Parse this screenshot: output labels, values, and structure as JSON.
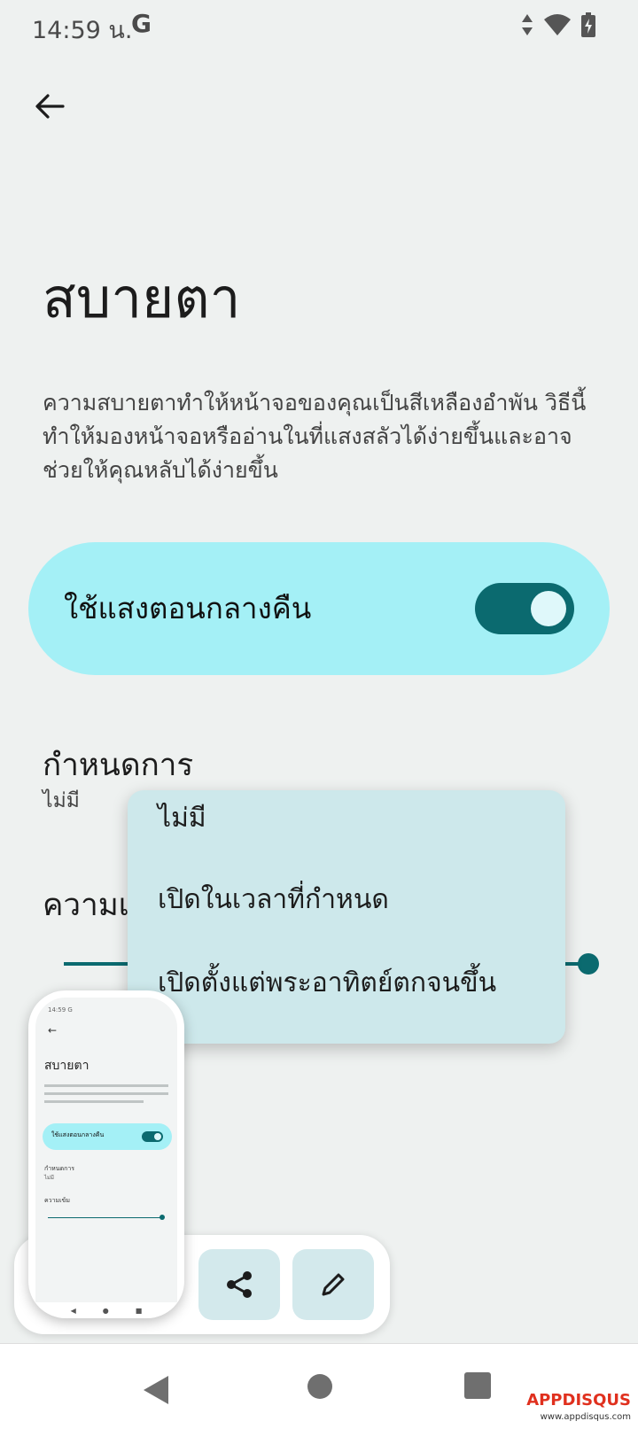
{
  "status_bar": {
    "time": "14:59 น.",
    "carrier_icon": "G"
  },
  "header": {
    "title": "สบายตา"
  },
  "description": "ความสบายตาทำให้หน้าจอของคุณเป็นสีเหลืองอำพัน วิธีนี้ทำให้มองหน้าจอหรืออ่านในที่แสงสลัวได้ง่ายขึ้นและอาจช่วยให้คุณหลับได้ง่ายขึ้น",
  "night_light": {
    "label": "ใช้แสงตอนกลางคืน",
    "enabled": true
  },
  "schedule": {
    "title": "กำหนดการ",
    "value": "ไม่มี"
  },
  "intensity": {
    "title": "ความเข้ม",
    "visible_title": "ความเ",
    "level": 1.0
  },
  "dropdown": {
    "options": [
      "ไม่มี",
      "เปิดในเวลาที่กำหนด",
      "เปิดตั้งแต่พระอาทิตย์ตกจนขึ้น"
    ]
  },
  "screenshot_preview": {
    "time": "14:59 G",
    "title": "สบายตา",
    "toggle_label": "ใช้แสงตอนกลางคืน",
    "schedule_title": "กำหนดการ",
    "schedule_value": "ไม่มี",
    "intensity_title": "ความเข้ม"
  },
  "toolbar": {
    "share_icon": "share-icon",
    "edit_icon": "pencil-icon"
  },
  "watermark": {
    "brand": "APPDISQUS",
    "url": "www.appdisqus.com"
  },
  "colors": {
    "accent": "#0b6a6f",
    "card": "#a4f0f6",
    "menu": "#cde8eb",
    "background": "#eef1f0"
  }
}
